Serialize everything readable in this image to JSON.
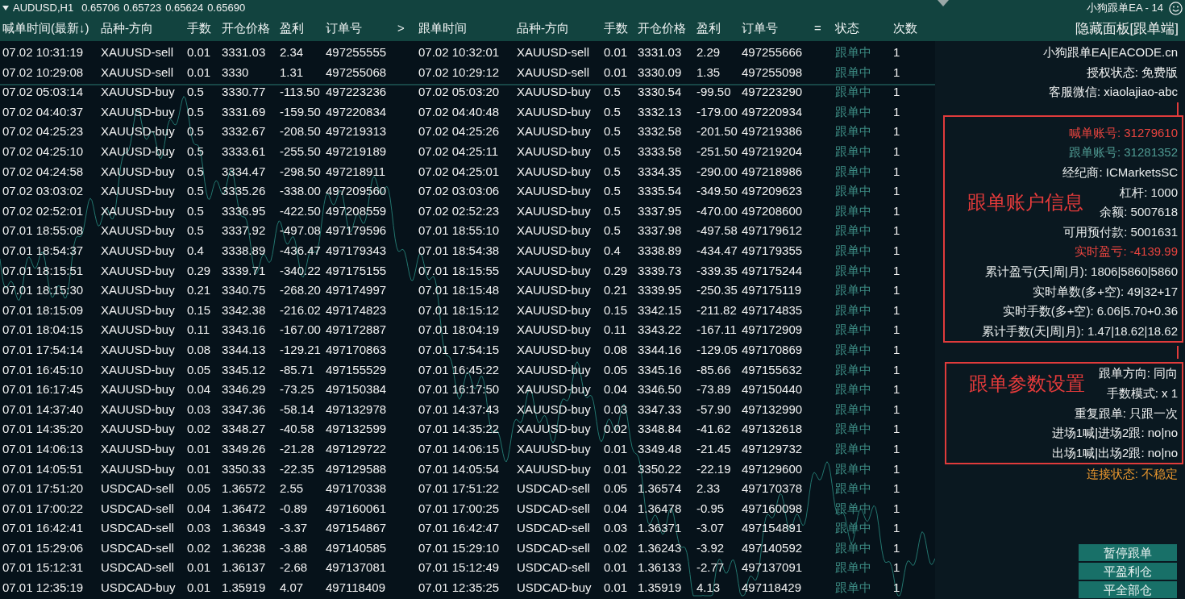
{
  "chart_header": {
    "symbol": "AUDUSD,H1",
    "prices": [
      "0.65706",
      "0.65723",
      "0.65624",
      "0.65690"
    ]
  },
  "ea_label": "小狗跟单EA - 14",
  "table": {
    "columns": [
      "喊单时间(最新↓)",
      "品种-方向",
      "手数",
      "开仓价格",
      "盈利",
      "订单号",
      ">",
      "跟单时间",
      "品种-方向",
      "手数",
      "开仓价格",
      "盈利",
      "订单号",
      "=",
      "状态",
      "次数"
    ],
    "rows": [
      [
        "07.02 10:31:19",
        "XAUUSD-sell",
        "0.01",
        "3331.03",
        "2.34",
        "497255555",
        "",
        "07.02 10:32:01",
        "XAUUSD-sell",
        "0.01",
        "3331.03",
        "2.29",
        "497255666",
        "",
        "跟单中",
        "1"
      ],
      [
        "07.02 10:29:08",
        "XAUUSD-sell",
        "0.01",
        "3330",
        "1.31",
        "497255068",
        "",
        "07.02 10:29:12",
        "XAUUSD-sell",
        "0.01",
        "3330.09",
        "1.35",
        "497255098",
        "",
        "跟单中",
        "1"
      ],
      [
        "07.02 05:03:14",
        "XAUUSD-buy",
        "0.5",
        "3330.77",
        "-113.50",
        "497223236",
        "",
        "07.02 05:03:20",
        "XAUUSD-buy",
        "0.5",
        "3330.54",
        "-99.50",
        "497223290",
        "",
        "跟单中",
        "1"
      ],
      [
        "07.02 04:40:37",
        "XAUUSD-buy",
        "0.5",
        "3331.69",
        "-159.50",
        "497220834",
        "",
        "07.02 04:40:48",
        "XAUUSD-buy",
        "0.5",
        "3332.13",
        "-179.00",
        "497220934",
        "",
        "跟单中",
        "1"
      ],
      [
        "07.02 04:25:23",
        "XAUUSD-buy",
        "0.5",
        "3332.67",
        "-208.50",
        "497219313",
        "",
        "07.02 04:25:26",
        "XAUUSD-buy",
        "0.5",
        "3332.58",
        "-201.50",
        "497219386",
        "",
        "跟单中",
        "1"
      ],
      [
        "07.02 04:25:10",
        "XAUUSD-buy",
        "0.5",
        "3333.61",
        "-255.50",
        "497219189",
        "",
        "07.02 04:25:11",
        "XAUUSD-buy",
        "0.5",
        "3333.58",
        "-251.50",
        "497219204",
        "",
        "跟单中",
        "1"
      ],
      [
        "07.02 04:24:58",
        "XAUUSD-buy",
        "0.5",
        "3334.47",
        "-298.50",
        "497218911",
        "",
        "07.02 04:25:01",
        "XAUUSD-buy",
        "0.5",
        "3334.35",
        "-290.00",
        "497218986",
        "",
        "跟单中",
        "1"
      ],
      [
        "07.02 03:03:02",
        "XAUUSD-buy",
        "0.5",
        "3335.26",
        "-338.00",
        "497209560",
        "",
        "07.02 03:03:06",
        "XAUUSD-buy",
        "0.5",
        "3335.54",
        "-349.50",
        "497209623",
        "",
        "跟单中",
        "1"
      ],
      [
        "07.02 02:52:01",
        "XAUUSD-buy",
        "0.5",
        "3336.95",
        "-422.50",
        "497208559",
        "",
        "07.02 02:52:23",
        "XAUUSD-buy",
        "0.5",
        "3337.95",
        "-470.00",
        "497208600",
        "",
        "跟单中",
        "1"
      ],
      [
        "07.01 18:55:08",
        "XAUUSD-buy",
        "0.5",
        "3337.92",
        "-497.08",
        "497179596",
        "",
        "07.01 18:55:10",
        "XAUUSD-buy",
        "0.5",
        "3337.98",
        "-497.58",
        "497179612",
        "",
        "跟单中",
        "1"
      ],
      [
        "07.01 18:54:37",
        "XAUUSD-buy",
        "0.4",
        "3338.89",
        "-436.47",
        "497179343",
        "",
        "07.01 18:54:38",
        "XAUUSD-buy",
        "0.4",
        "3338.89",
        "-434.47",
        "497179355",
        "",
        "跟单中",
        "1"
      ],
      [
        "07.01 18:15:51",
        "XAUUSD-buy",
        "0.29",
        "3339.71",
        "-340.22",
        "497175155",
        "",
        "07.01 18:15:55",
        "XAUUSD-buy",
        "0.29",
        "3339.73",
        "-339.35",
        "497175244",
        "",
        "跟单中",
        "1"
      ],
      [
        "07.01 18:15:30",
        "XAUUSD-buy",
        "0.21",
        "3340.75",
        "-268.20",
        "497174997",
        "",
        "07.01 18:15:48",
        "XAUUSD-buy",
        "0.21",
        "3339.95",
        "-250.35",
        "497175119",
        "",
        "跟单中",
        "1"
      ],
      [
        "07.01 18:15:09",
        "XAUUSD-buy",
        "0.15",
        "3342.38",
        "-216.02",
        "497174823",
        "",
        "07.01 18:15:12",
        "XAUUSD-buy",
        "0.15",
        "3342.15",
        "-211.82",
        "497174835",
        "",
        "跟单中",
        "1"
      ],
      [
        "07.01 18:04:15",
        "XAUUSD-buy",
        "0.11",
        "3343.16",
        "-167.00",
        "497172887",
        "",
        "07.01 18:04:19",
        "XAUUSD-buy",
        "0.11",
        "3343.22",
        "-167.11",
        "497172909",
        "",
        "跟单中",
        "1"
      ],
      [
        "07.01 17:54:14",
        "XAUUSD-buy",
        "0.08",
        "3344.13",
        "-129.21",
        "497170863",
        "",
        "07.01 17:54:15",
        "XAUUSD-buy",
        "0.08",
        "3344.16",
        "-129.05",
        "497170869",
        "",
        "跟单中",
        "1"
      ],
      [
        "07.01 16:45:10",
        "XAUUSD-buy",
        "0.05",
        "3345.12",
        "-85.71",
        "497155529",
        "",
        "07.01 16:45:22",
        "XAUUSD-buy",
        "0.05",
        "3345.16",
        "-85.66",
        "497155632",
        "",
        "跟单中",
        "1"
      ],
      [
        "07.01 16:17:45",
        "XAUUSD-buy",
        "0.04",
        "3346.29",
        "-73.25",
        "497150384",
        "",
        "07.01 16:17:50",
        "XAUUSD-buy",
        "0.04",
        "3346.50",
        "-73.89",
        "497150440",
        "",
        "跟单中",
        "1"
      ],
      [
        "07.01 14:37:40",
        "XAUUSD-buy",
        "0.03",
        "3347.36",
        "-58.14",
        "497132978",
        "",
        "07.01 14:37:43",
        "XAUUSD-buy",
        "0.03",
        "3347.33",
        "-57.90",
        "497132990",
        "",
        "跟单中",
        "1"
      ],
      [
        "07.01 14:35:20",
        "XAUUSD-buy",
        "0.02",
        "3348.27",
        "-40.58",
        "497132599",
        "",
        "07.01 14:35:22",
        "XAUUSD-buy",
        "0.02",
        "3348.84",
        "-41.62",
        "497132618",
        "",
        "跟单中",
        "1"
      ],
      [
        "07.01 14:06:13",
        "XAUUSD-buy",
        "0.01",
        "3349.26",
        "-21.28",
        "497129722",
        "",
        "07.01 14:06:15",
        "XAUUSD-buy",
        "0.01",
        "3349.48",
        "-21.45",
        "497129732",
        "",
        "跟单中",
        "1"
      ],
      [
        "07.01 14:05:51",
        "XAUUSD-buy",
        "0.01",
        "3350.33",
        "-22.35",
        "497129588",
        "",
        "07.01 14:05:54",
        "XAUUSD-buy",
        "0.01",
        "3350.22",
        "-22.19",
        "497129600",
        "",
        "跟单中",
        "1"
      ],
      [
        "07.01 17:51:20",
        "USDCAD-sell",
        "0.05",
        "1.36572",
        "2.55",
        "497170338",
        "",
        "07.01 17:51:22",
        "USDCAD-sell",
        "0.05",
        "1.36574",
        "2.33",
        "497170378",
        "",
        "跟单中",
        "1"
      ],
      [
        "07.01 17:00:22",
        "USDCAD-sell",
        "0.04",
        "1.36472",
        "-0.89",
        "497160061",
        "",
        "07.01 17:00:25",
        "USDCAD-sell",
        "0.04",
        "1.36478",
        "-0.95",
        "497160098",
        "",
        "跟单中",
        "1"
      ],
      [
        "07.01 16:42:41",
        "USDCAD-sell",
        "0.03",
        "1.36349",
        "-3.37",
        "497154867",
        "",
        "07.01 16:42:47",
        "USDCAD-sell",
        "0.03",
        "1.36371",
        "-3.07",
        "497154891",
        "",
        "跟单中",
        "1"
      ],
      [
        "07.01 15:29:06",
        "USDCAD-sell",
        "0.02",
        "1.36238",
        "-3.88",
        "497140585",
        "",
        "07.01 15:29:10",
        "USDCAD-sell",
        "0.02",
        "1.36243",
        "-3.92",
        "497140592",
        "",
        "跟单中",
        "1"
      ],
      [
        "07.01 15:12:31",
        "USDCAD-sell",
        "0.01",
        "1.36137",
        "-2.68",
        "497137081",
        "",
        "07.01 15:12:49",
        "USDCAD-sell",
        "0.01",
        "1.36133",
        "-2.77",
        "497137091",
        "",
        "跟单中",
        "1"
      ],
      [
        "07.01 12:35:19",
        "USDCAD-buy",
        "0.01",
        "1.35919",
        "4.07",
        "497118409",
        "",
        "07.01 12:35:25",
        "USDCAD-buy",
        "0.01",
        "1.35919",
        "4.13",
        "497118429",
        "",
        "跟单中",
        "1"
      ]
    ]
  },
  "panel": {
    "toggle": "隐藏面板[跟单端]",
    "info_lines": [
      "小狗跟单EA|EACODE.cn",
      "授权状态: 免费版",
      "客服微信: xiaolajiao-abc"
    ],
    "account_box": {
      "title": "跟单账户信息",
      "lines": [
        {
          "text": "喊单账号: 31279610",
          "color": "#e8443f"
        },
        {
          "text": "跟单账号: 31281352",
          "color": "#4f9a92"
        },
        {
          "text": "经纪商: ICMarketsSC",
          "color": "#e8ecec"
        },
        {
          "text": "杠杆: 1000",
          "color": "#e8ecec"
        },
        {
          "text": "余额: 5007618",
          "color": "#e8ecec"
        },
        {
          "text": "可用预付款: 5001631",
          "color": "#e8ecec"
        },
        {
          "text": "实时盈亏: -4139.99",
          "color": "#e8443f"
        },
        {
          "text": "累计盈亏(天|周|月): 1806|5860|5860",
          "color": "#e8ecec"
        },
        {
          "text": "实时单数(多+空): 49|32+17",
          "color": "#e8ecec"
        },
        {
          "text": "实时手数(多+空): 6.06|5.70+0.36",
          "color": "#e8ecec"
        },
        {
          "text": "累计手数(天|周|月): 1.47|18.62|18.62",
          "color": "#e8ecec"
        }
      ]
    },
    "settings_box": {
      "title": "跟单参数设置",
      "lines": [
        "跟单方向: 同向",
        "手数模式: x 1",
        "重复跟单: 只跟一次",
        "进场1喊|进场2跟: no|no",
        "出场1喊|出场2跟: no|no"
      ]
    },
    "connection": "连接状态: 不稳定",
    "buttons": [
      "暂停跟单",
      "平盈利仓",
      "平全部仓"
    ]
  }
}
